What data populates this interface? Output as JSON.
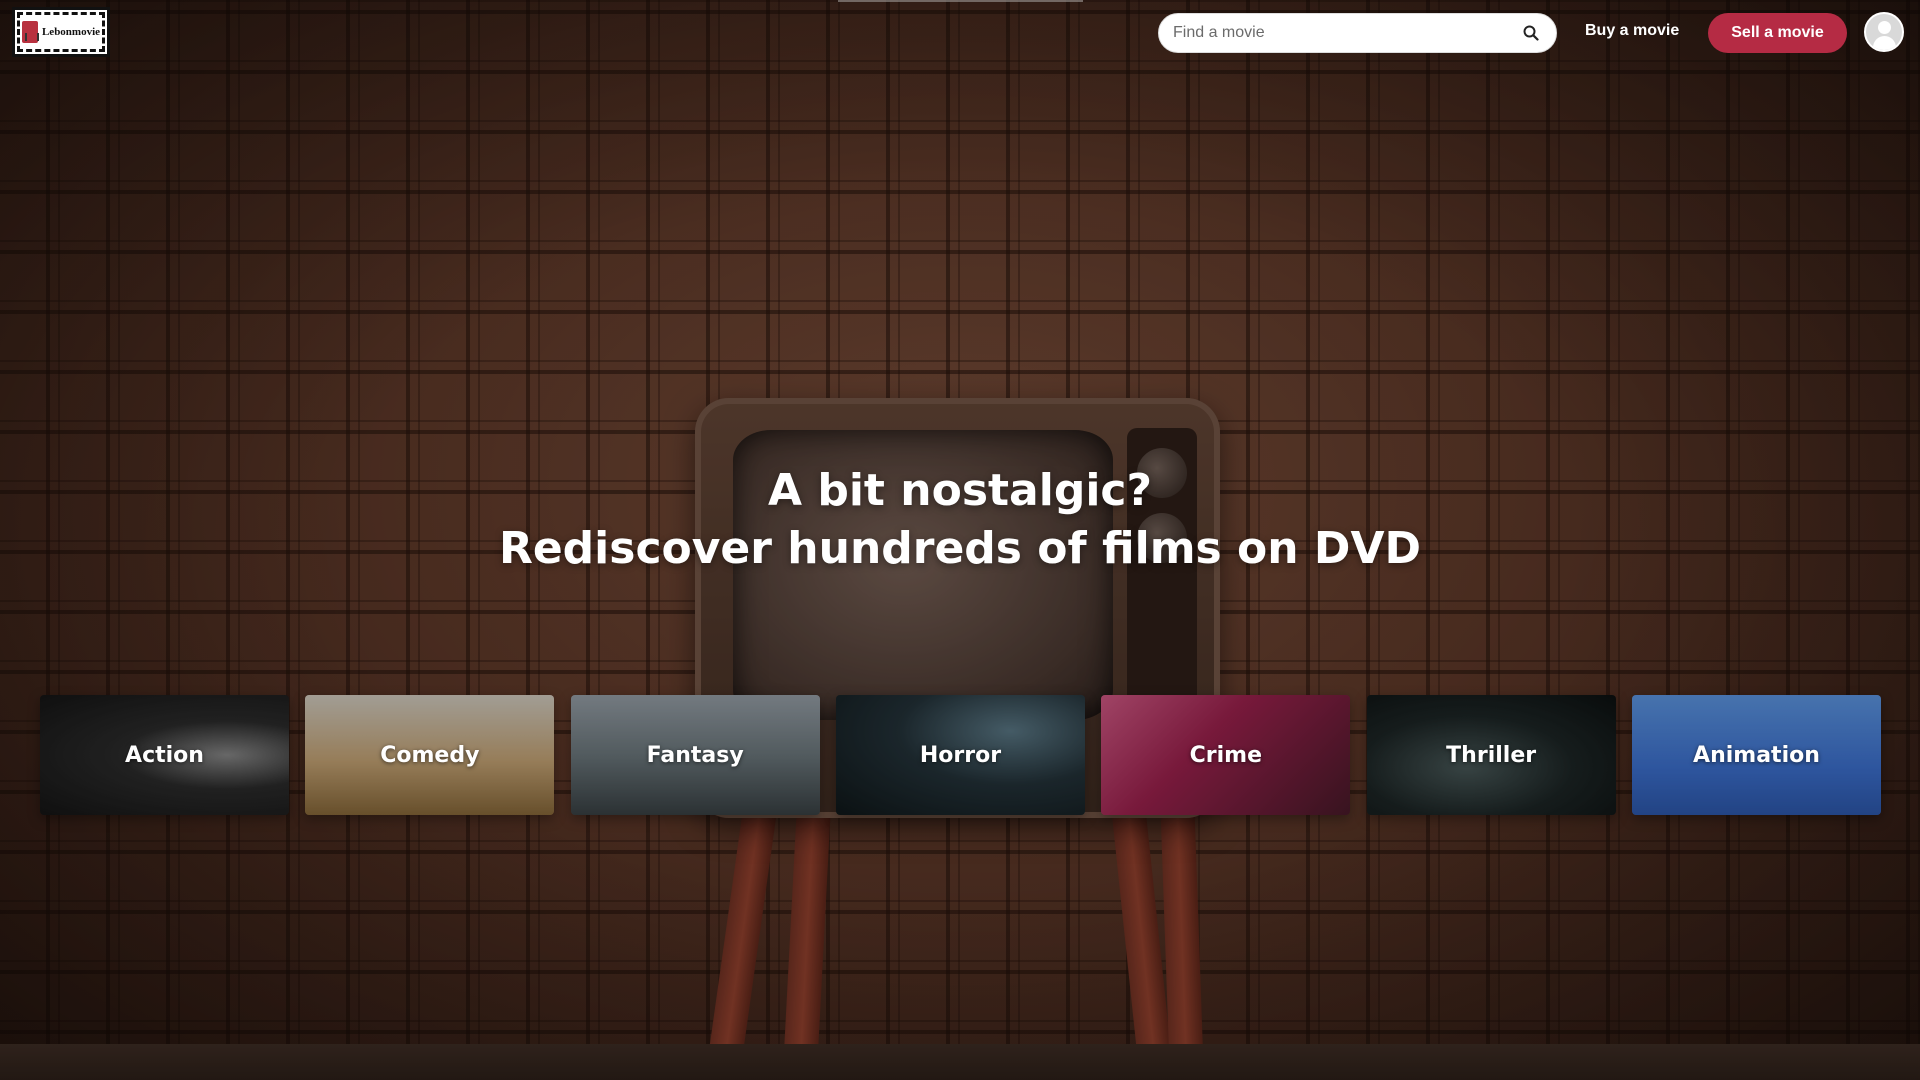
{
  "header": {
    "logo_text": "Lebonmovie",
    "search": {
      "placeholder": "Find a movie",
      "icon": "search-icon"
    },
    "buy_label": "Buy a movie",
    "sell_label": "Sell a movie",
    "avatar_icon": "user-avatar-icon"
  },
  "hero": {
    "line1": "A bit nostalgic?",
    "line2": "Rediscover hundreds of films on DVD"
  },
  "genres": [
    {
      "label": "Action"
    },
    {
      "label": "Comedy"
    },
    {
      "label": "Fantasy"
    },
    {
      "label": "Horror"
    },
    {
      "label": "Crime"
    },
    {
      "label": "Thriller"
    },
    {
      "label": "Animation"
    }
  ],
  "colors": {
    "accent": "#b52b44",
    "text_light": "#ffffff"
  }
}
